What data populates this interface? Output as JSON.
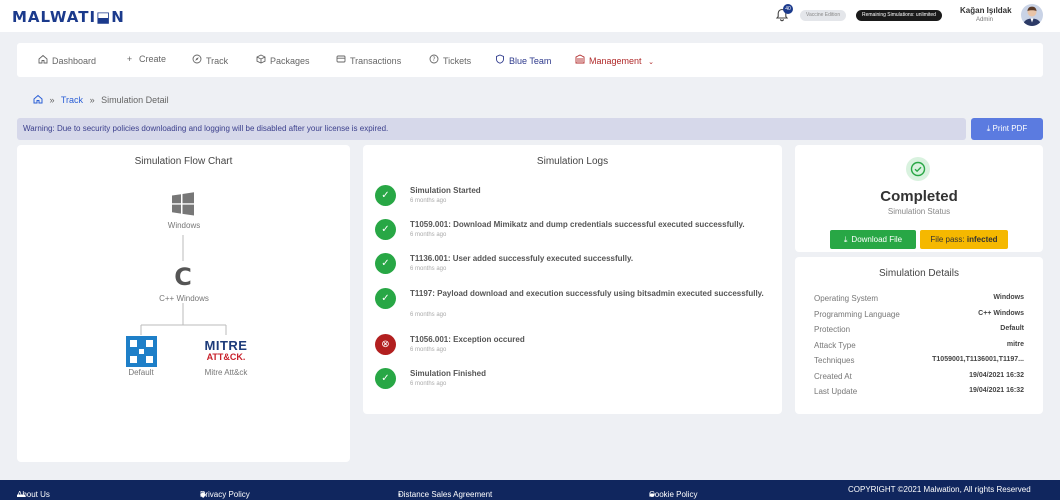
{
  "header": {
    "logo": "MALWATI⬓N",
    "notification_count": "40",
    "edition": "Vaccine Edition",
    "remaining": "Remaining Simulations: unlimited",
    "user_name": "Kağan Işıldak",
    "user_role": "Admin"
  },
  "nav": {
    "items": [
      {
        "label": "Dashboard",
        "icon": "home-icon"
      },
      {
        "label": "Create",
        "icon": "plus-icon"
      },
      {
        "label": "Track",
        "icon": "compass-icon"
      },
      {
        "label": "Packages",
        "icon": "box-icon"
      },
      {
        "label": "Transactions",
        "icon": "card-icon"
      },
      {
        "label": "Tickets",
        "icon": "help-icon"
      },
      {
        "label": "Blue Team",
        "icon": "shield-icon"
      },
      {
        "label": "Management",
        "icon": "building-icon"
      }
    ]
  },
  "breadcrumb": {
    "sep": "»",
    "track": "Track",
    "current": "Simulation Detail"
  },
  "warning": "Warning: Due to security policies downloading and logging will be disabled after your license is expired.",
  "print_pdf": "Print PDF",
  "flow": {
    "title": "Simulation Flow Chart",
    "os": "Windows",
    "language": "C++ Windows",
    "c_letter": "C",
    "protection": "Default",
    "attack": "Mitre Att&ck",
    "mitre_logo_top": "MITRE",
    "mitre_logo_bottom": "ATT&CK."
  },
  "logs": {
    "title": "Simulation Logs",
    "items": [
      {
        "text": "Simulation Started",
        "time": "6 months ago",
        "status": "success"
      },
      {
        "text": "T1059.001: Download Mimikatz and dump credentials successful executed successfully.",
        "time": "6 months ago",
        "status": "success"
      },
      {
        "text": "T1136.001: User added successfuly executed successfully.",
        "time": "6 months ago",
        "status": "success"
      },
      {
        "text": "T1197: Payload download and execution successfuly using bitsadmin executed successfully.",
        "time": "6 months ago",
        "status": "success"
      },
      {
        "text": "T1056.001: Exception occured",
        "time": "6 months ago",
        "status": "error"
      },
      {
        "text": "Simulation Finished",
        "time": "6 months ago",
        "status": "success"
      }
    ]
  },
  "status": {
    "title": "Completed",
    "subtitle": "Simulation Status",
    "download": "Download File",
    "file_pass_label": "File pass:",
    "file_pass_value": "infected"
  },
  "details": {
    "title": "Simulation Details",
    "rows": [
      {
        "k": "Operating System",
        "v": "Windows"
      },
      {
        "k": "Programming Language",
        "v": "C++ Windows"
      },
      {
        "k": "Protection",
        "v": "Default"
      },
      {
        "k": "Attack Type",
        "v": "mitre"
      },
      {
        "k": "Techniques",
        "v": "T1059001,T1136001,T1197..."
      },
      {
        "k": "Created At",
        "v": "19/04/2021 16:32"
      },
      {
        "k": "Last Update",
        "v": "19/04/2021 16:32"
      }
    ]
  },
  "footer": {
    "about": "About Us",
    "privacy": "Privacy Policy",
    "distance": "Distance Sales Agreement",
    "cookie": "Cookie Policy",
    "copyright": "COPYRIGHT ©2021 Malwation, All rights Reserved"
  },
  "colors": {
    "success": "#28a745",
    "error": "#b21f1f",
    "primary": "#1b3a8c"
  }
}
